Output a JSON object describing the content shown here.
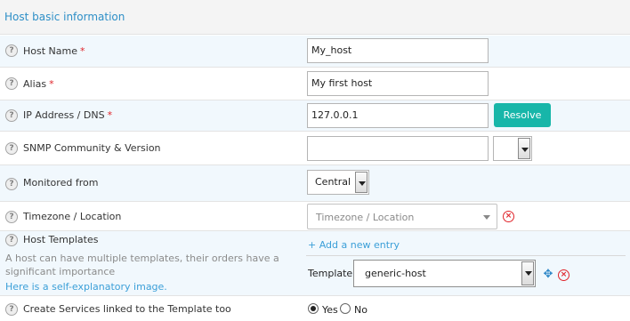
{
  "section": {
    "title": "Host basic information"
  },
  "fields": {
    "host_name": {
      "label": "Host Name",
      "required": "*",
      "value": "My_host"
    },
    "alias": {
      "label": "Alias",
      "required": "*",
      "value": "My first host"
    },
    "ip": {
      "label": "IP Address / DNS",
      "required": "*",
      "value": "127.0.0.1",
      "button": "Resolve"
    },
    "snmp": {
      "label": "SNMP Community & Version",
      "value": "",
      "version": ""
    },
    "monitored_from": {
      "label": "Monitored from",
      "value": "Central"
    },
    "timezone": {
      "label": "Timezone / Location",
      "placeholder": "Timezone / Location"
    },
    "templates": {
      "label": "Host Templates",
      "add_entry": "+ Add a new entry",
      "description_line1": "A host can have multiple templates, their orders have a",
      "description_line2": "significant importance",
      "help_link": "Here is a self-explanatory image.",
      "template_label": "Template",
      "template_value": "generic-host"
    },
    "create_services": {
      "label": "Create Services linked to the Template too",
      "options": [
        "Yes",
        "No"
      ],
      "selected": "Yes"
    }
  },
  "icons": {
    "help": "question-mark-icon",
    "remove": "remove-circle-icon",
    "move": "move-arrows-icon"
  },
  "colors": {
    "accent": "#2e8fc7",
    "button": "#17b6a9",
    "required": "#e0242a",
    "link": "#3b9fd8"
  }
}
